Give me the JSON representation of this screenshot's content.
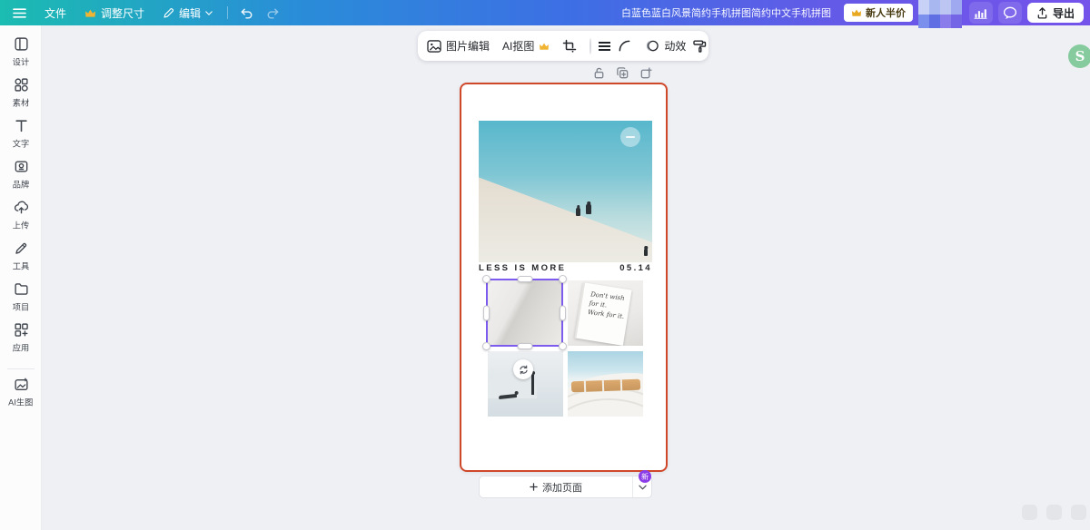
{
  "topbar": {
    "file": "文件",
    "resize": "调整尺寸",
    "edit": "编辑",
    "title": "白蓝色蓝白风景简约手机拼图简约中文手机拼图",
    "promo": "新人半价",
    "export": "导出"
  },
  "sidebar": {
    "items": [
      {
        "label": "设计"
      },
      {
        "label": "素材"
      },
      {
        "label": "文字"
      },
      {
        "label": "品牌"
      },
      {
        "label": "上传"
      },
      {
        "label": "工具"
      },
      {
        "label": "项目"
      },
      {
        "label": "应用"
      },
      {
        "label": "AI生图"
      }
    ]
  },
  "toolbar": {
    "image_edit": "图片编辑",
    "ai_cutout": "AI抠图",
    "motion": "动效"
  },
  "canvas": {
    "caption_left": "LESS IS MORE",
    "caption_right": "05.14",
    "note_lines": [
      "Don't wish",
      "for it.",
      "Work for it."
    ]
  },
  "footer": {
    "add_page": "添加页面",
    "new_badge": "新"
  },
  "colors": {
    "topbar_start": "#1bbcb1",
    "topbar_mid": "#3d6fe4",
    "topbar_end": "#7453ea",
    "page_border": "#d0482a",
    "selection": "#7e5bef",
    "crown_gold": "#f0b432",
    "new_badge_bg": "#8b3de8",
    "logo_green": "#85cb9e"
  }
}
